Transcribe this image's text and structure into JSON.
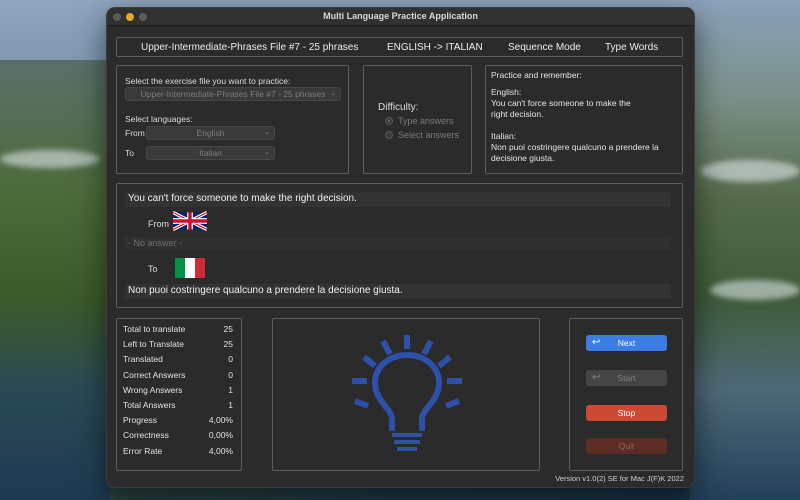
{
  "window": {
    "title": "Multi Language Practice Application"
  },
  "header": {
    "file": "Upper-Intermediate-Phrases File #7 - 25 phrases",
    "direction": "ENGLISH -> ITALIAN",
    "mode": "Sequence Mode",
    "type": "Type Words"
  },
  "settings": {
    "file_label": "Select the exercise file you want to practice:",
    "file_value": "Upper-Intermediate-Phrases File #7 - 25 phrases",
    "languages_label": "Select languages:",
    "from_label": "From",
    "from_value": "English",
    "to_label": "To",
    "to_value": "Italian"
  },
  "difficulty": {
    "label": "Difficulty:",
    "options": [
      "Type answers",
      "Select answers"
    ],
    "selected": "Type answers"
  },
  "practice": {
    "title": "Practice and remember:",
    "english_label": "English:",
    "english_line1": "You can't force someone to make the",
    "english_line2": "right decision.",
    "italian_label": "Italian:",
    "italian_line1": "Non puoi costringere qualcuno a prendere la",
    "italian_line2": "decisione giusta."
  },
  "exercise": {
    "source_sentence": "You can't force someone to make the right decision.",
    "from_label": "From",
    "answer_placeholder": "- No answer -",
    "to_label": "To",
    "target_sentence": "Non puoi costringere qualcuno a prendere la decisione giusta."
  },
  "stats": [
    {
      "label": "Total to translate",
      "value": "25"
    },
    {
      "label": "Left to Translate",
      "value": "25"
    },
    {
      "label": "Translated",
      "value": "0"
    },
    {
      "label": "Correct Answers",
      "value": "0"
    },
    {
      "label": "Wrong Answers",
      "value": "1"
    },
    {
      "label": "Total Answers",
      "value": "1"
    },
    {
      "label": "Progress",
      "value": "4,00%"
    },
    {
      "label": "Correctness",
      "value": "0,00%"
    },
    {
      "label": "Error Rate",
      "value": "4,00%"
    }
  ],
  "buttons": {
    "next": "Next",
    "start": "Start",
    "stop": "Stop",
    "quit": "Quit"
  },
  "footer": {
    "version": "Version v1.0(2) SE for Mac J(F)K 2022"
  },
  "colors": {
    "accent": "#3b7de3",
    "stop": "#cc4a33",
    "bulb": "#2d50a8",
    "window_bg": "#2b2b2b"
  },
  "icons": {
    "bulb": "lightbulb-icon",
    "flag_from": "uk-flag-icon",
    "flag_to": "italy-flag-icon",
    "return": "return-arrow-icon"
  }
}
